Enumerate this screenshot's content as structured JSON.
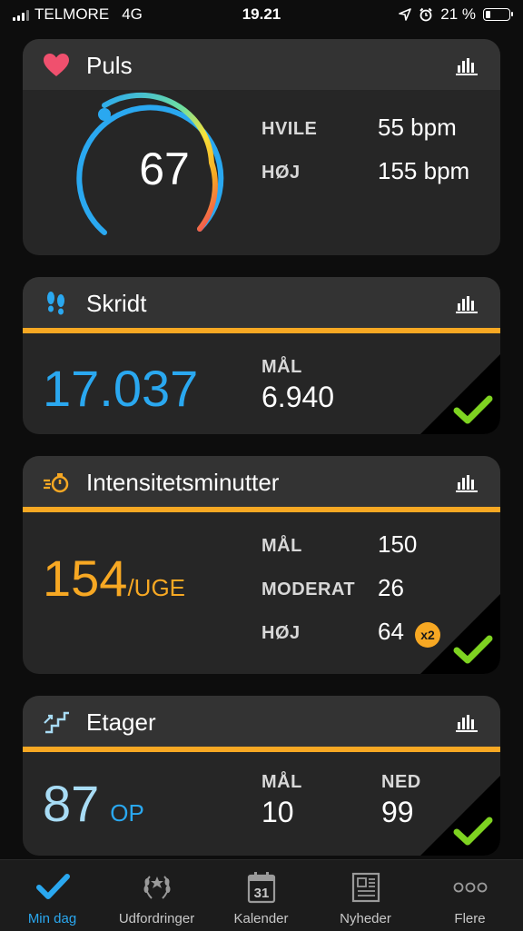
{
  "status_bar": {
    "carrier": "TELMORE",
    "network": "4G",
    "time": "19.21",
    "battery": "21 %",
    "battery_level": 0.21
  },
  "colors": {
    "blue": "#2aa8f0",
    "orange": "#f7a823",
    "green": "#7ed321",
    "heart": "#f0506e",
    "light_blue": "#a8dcf5"
  },
  "pulse": {
    "title": "Puls",
    "icon": "heart-icon",
    "current": "67",
    "rest_label": "HVILE",
    "rest_value": "55 bpm",
    "high_label": "HØJ",
    "high_value": "155 bpm"
  },
  "steps": {
    "title": "Skridt",
    "icon": "footprints-icon",
    "value": "17.037",
    "goal_label": "MÅL",
    "goal_value": "6.940",
    "goal_met": true
  },
  "intensity": {
    "title": "Intensitetsminutter",
    "icon": "stopwatch-icon",
    "value": "154",
    "unit": "/UGE",
    "goal_label": "MÅL",
    "goal_value": "150",
    "moderate_label": "MODERAT",
    "moderate_value": "26",
    "high_label": "HØJ",
    "high_value": "64",
    "multiplier": "x2",
    "goal_met": true
  },
  "floors": {
    "title": "Etager",
    "icon": "stairs-icon",
    "value": "87",
    "unit": "OP",
    "goal_label": "MÅL",
    "goal_value": "10",
    "down_label": "NED",
    "down_value": "99",
    "goal_met": true
  },
  "tabs": [
    {
      "label": "Min dag",
      "icon": "checkmark-icon",
      "active": true
    },
    {
      "label": "Udfordringer",
      "icon": "laurel-icon",
      "active": false
    },
    {
      "label": "Kalender",
      "icon": "calendar-icon",
      "calendar_day": "31",
      "active": false
    },
    {
      "label": "Nyheder",
      "icon": "newspaper-icon",
      "active": false
    },
    {
      "label": "Flere",
      "icon": "more-icon",
      "active": false
    }
  ]
}
